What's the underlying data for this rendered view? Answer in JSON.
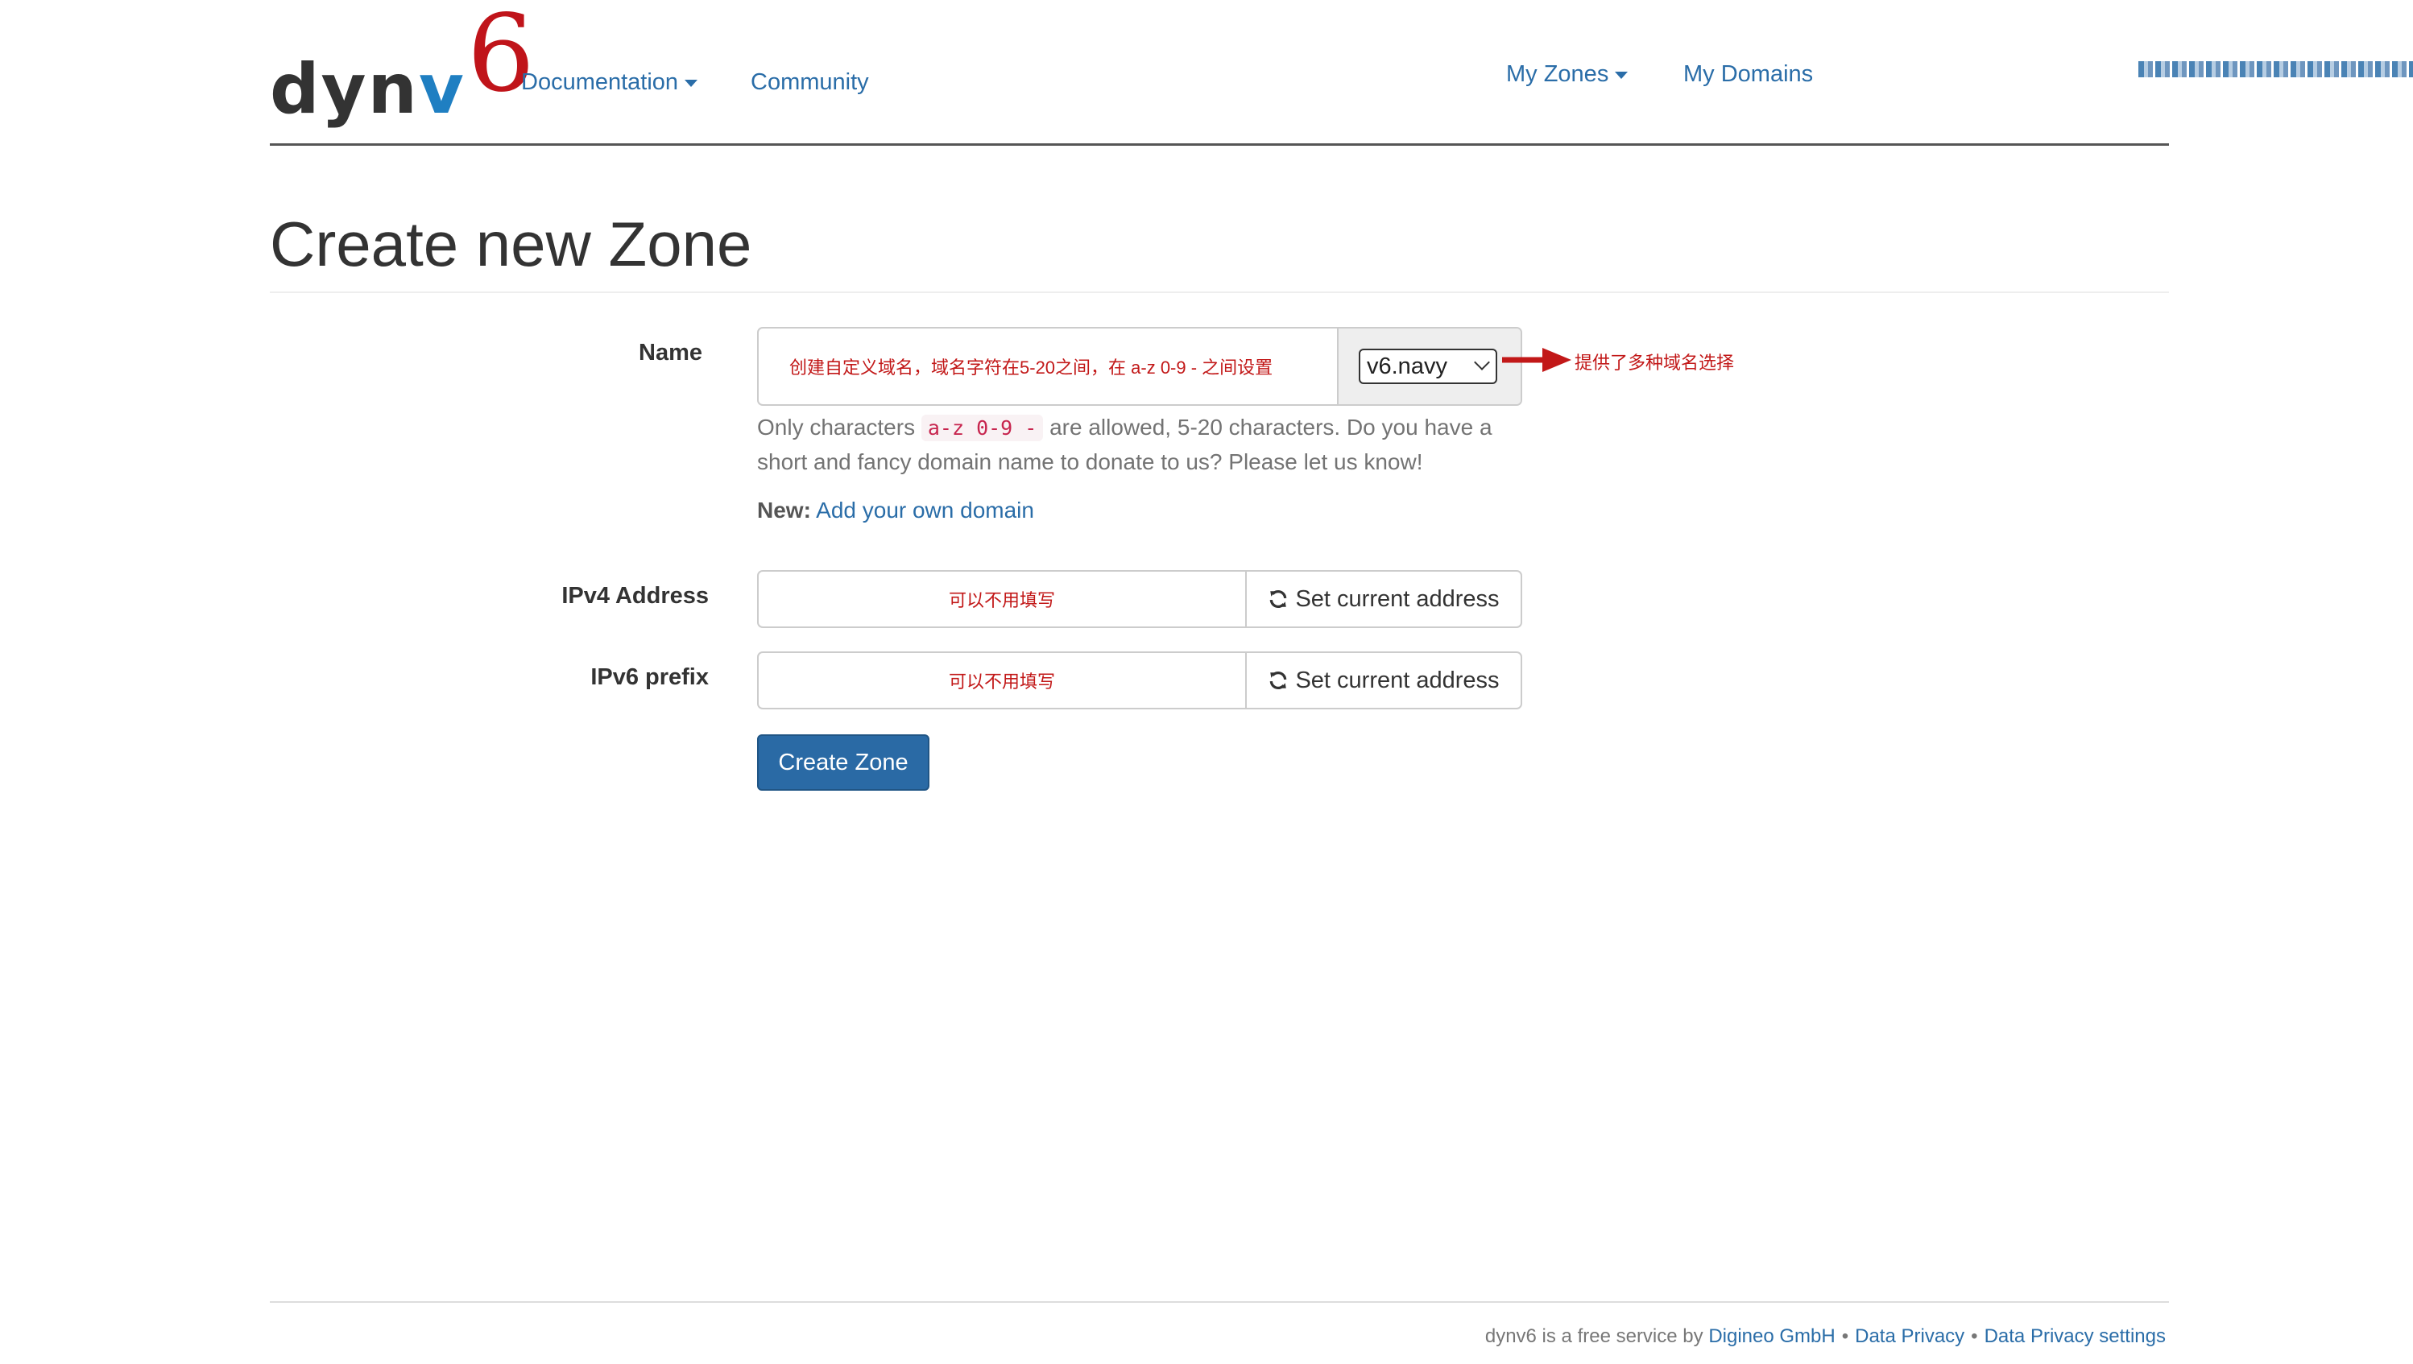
{
  "brand": {
    "part1": "dyn",
    "part2": "v",
    "part3": "6"
  },
  "nav": {
    "documentation": "Documentation",
    "community": "Community",
    "my_zones": "My Zones",
    "my_domains": "My Domains"
  },
  "page": {
    "title": "Create new Zone"
  },
  "form": {
    "name_label": "Name",
    "name_value": "创建自定义域名，域名字符在5-20之间，在 a-z 0-9 - 之间设置",
    "domain_select": "v6.navy",
    "annotation": "提供了多种域名选择",
    "help_before": "Only characters ",
    "help_code": "a-z 0-9 -",
    "help_after": " are allowed, 5-20 characters. Do you have a short and fancy domain name to donate to us? Please let us know!",
    "new_label": "New:",
    "new_link": "Add your own domain",
    "ipv4_label": "IPv4 Address",
    "ipv4_value": "可以不用填写",
    "ipv6_label": "IPv6 prefix",
    "ipv6_value": "可以不用填写",
    "set_current": "Set current address",
    "submit": "Create Zone"
  },
  "footer": {
    "text": "dynv6 is a free service by",
    "company": "Digineo GmbH",
    "privacy": "Data Privacy",
    "privacy_settings": "Data Privacy settings",
    "sep": "•"
  },
  "colors": {
    "link": "#2a6da8",
    "brand_v": "#1f7fc2",
    "brand_6": "#c0141a",
    "primary_button": "#2a6aa5",
    "annotation": "#c21818"
  },
  "icons": [
    "caret-down-icon",
    "refresh-icon",
    "arrow-right-icon",
    "chevron-down-icon"
  ]
}
